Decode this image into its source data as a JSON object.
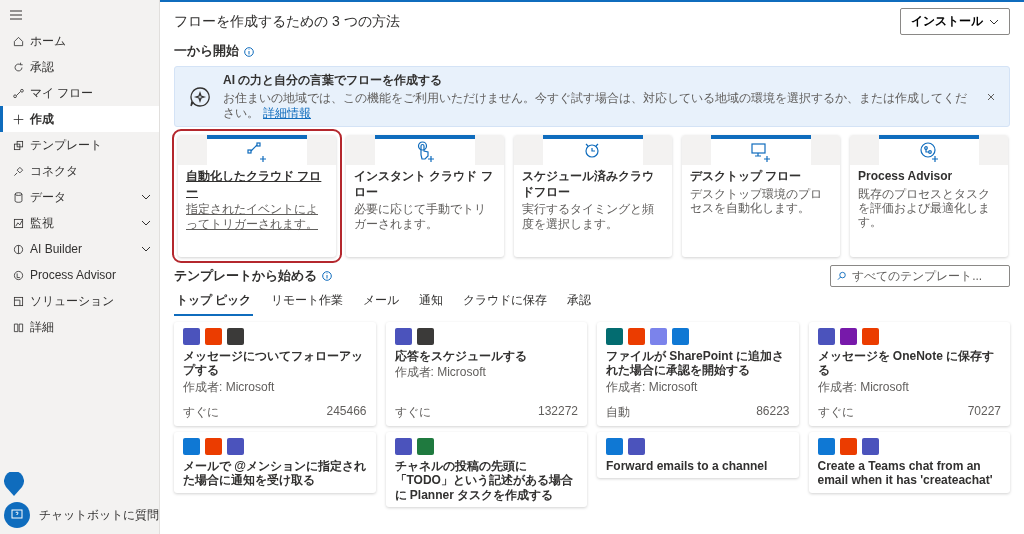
{
  "sidebar": {
    "items": [
      {
        "label": "ホーム",
        "selected": false,
        "expandable": false
      },
      {
        "label": "承認",
        "selected": false,
        "expandable": false
      },
      {
        "label": "マイ フロー",
        "selected": false,
        "expandable": false
      },
      {
        "label": "作成",
        "selected": true,
        "expandable": false
      },
      {
        "label": "テンプレート",
        "selected": false,
        "expandable": false
      },
      {
        "label": "コネクタ",
        "selected": false,
        "expandable": false
      },
      {
        "label": "データ",
        "selected": false,
        "expandable": true
      },
      {
        "label": "監視",
        "selected": false,
        "expandable": true
      },
      {
        "label": "AI Builder",
        "selected": false,
        "expandable": true
      },
      {
        "label": "Process Advisor",
        "selected": false,
        "expandable": false
      },
      {
        "label": "ソリューション",
        "selected": false,
        "expandable": false
      },
      {
        "label": "詳細",
        "selected": false,
        "expandable": false
      }
    ],
    "chatbot": "チャットボットに質問"
  },
  "page_title": "フローを作成するための 3 つの方法",
  "install_button": "インストール",
  "blank_section": {
    "title": "一から開始",
    "banner": {
      "title": "AI の力と自分の言葉でフローを作成する",
      "text": "お住まいの地域では、この機能をご利用いただけません。今すぐ試す場合は、対応している地域の環境を選択するか、または作成してください。",
      "link": "詳細情報"
    },
    "flow_types": [
      {
        "title": "自動化したクラウド フロー",
        "description": "指定されたイベントによってトリガーされます。",
        "selected": true
      },
      {
        "title": "インスタント クラウド フロー",
        "description": "必要に応じて手動でトリガーされます。",
        "selected": false
      },
      {
        "title": "スケジュール済みクラウドフロー",
        "description": "実行するタイミングと頻度を選択します。",
        "selected": false
      },
      {
        "title": "デスクトップ フロー",
        "description": "デスクトップ環境のプロセスを自動化します。",
        "selected": false
      },
      {
        "title": "Process Advisor",
        "description": "既存のプロセスとタスクを評価および最適化します。",
        "selected": false
      }
    ]
  },
  "templates_section": {
    "title": "テンプレートから始める",
    "search": {
      "placeholder": "すべてのテンプレート..."
    },
    "tabs": [
      {
        "label": "トップ ピック",
        "selected": true
      },
      {
        "label": "リモート作業",
        "selected": false
      },
      {
        "label": "メール",
        "selected": false
      },
      {
        "label": "通知",
        "selected": false
      },
      {
        "label": "クラウドに保存",
        "selected": false
      },
      {
        "label": "承認",
        "selected": false
      }
    ],
    "templates": [
      {
        "apps": [
          {
            "color": "#4b53bc"
          },
          {
            "color": "#eb3c00"
          },
          {
            "color": "#3b3a39"
          }
        ],
        "title": "メッセージについてフォローアップする",
        "author": "作成者: Microsoft",
        "trigger": "すぐに",
        "count": "245466"
      },
      {
        "apps": [
          {
            "color": "#4b53bc"
          },
          {
            "color": "#3b3a39"
          }
        ],
        "title": "応答をスケジュールする",
        "author": "作成者: Microsoft",
        "trigger": "すぐに",
        "count": "132272"
      },
      {
        "apps": [
          {
            "color": "#036c70"
          },
          {
            "color": "#eb3c00"
          },
          {
            "color": "#7b83eb"
          },
          {
            "color": "#0f78d4"
          }
        ],
        "title": "ファイルが SharePoint に追加された場合に承認を開始する",
        "author": "作成者: Microsoft",
        "trigger": "自動",
        "count": "86223"
      },
      {
        "apps": [
          {
            "color": "#4b53bc"
          },
          {
            "color": "#7719aa"
          },
          {
            "color": "#eb3c00"
          }
        ],
        "title": "メッセージを OneNote に保存する",
        "author": "作成者: Microsoft",
        "trigger": "すぐに",
        "count": "70227"
      },
      {
        "apps": [
          {
            "color": "#0f78d4"
          },
          {
            "color": "#eb3c00"
          },
          {
            "color": "#4b53bc"
          }
        ],
        "title": "メールで @メンションに指定された場合に通知を受け取る"
      },
      {
        "apps": [
          {
            "color": "#4b53bc"
          },
          {
            "color": "#1f7a3f"
          }
        ],
        "title": "チャネルの投稿の先頭に「TODO」という記述がある場合に Planner タスクを作成する"
      },
      {
        "apps": [
          {
            "color": "#0f78d4"
          },
          {
            "color": "#4b53bc"
          }
        ],
        "title": "Forward emails to a channel"
      },
      {
        "apps": [
          {
            "color": "#0f78d4"
          },
          {
            "color": "#eb3c00"
          },
          {
            "color": "#4b53bc"
          }
        ],
        "title": "Create a Teams chat from an email when it has 'createachat'"
      }
    ]
  }
}
